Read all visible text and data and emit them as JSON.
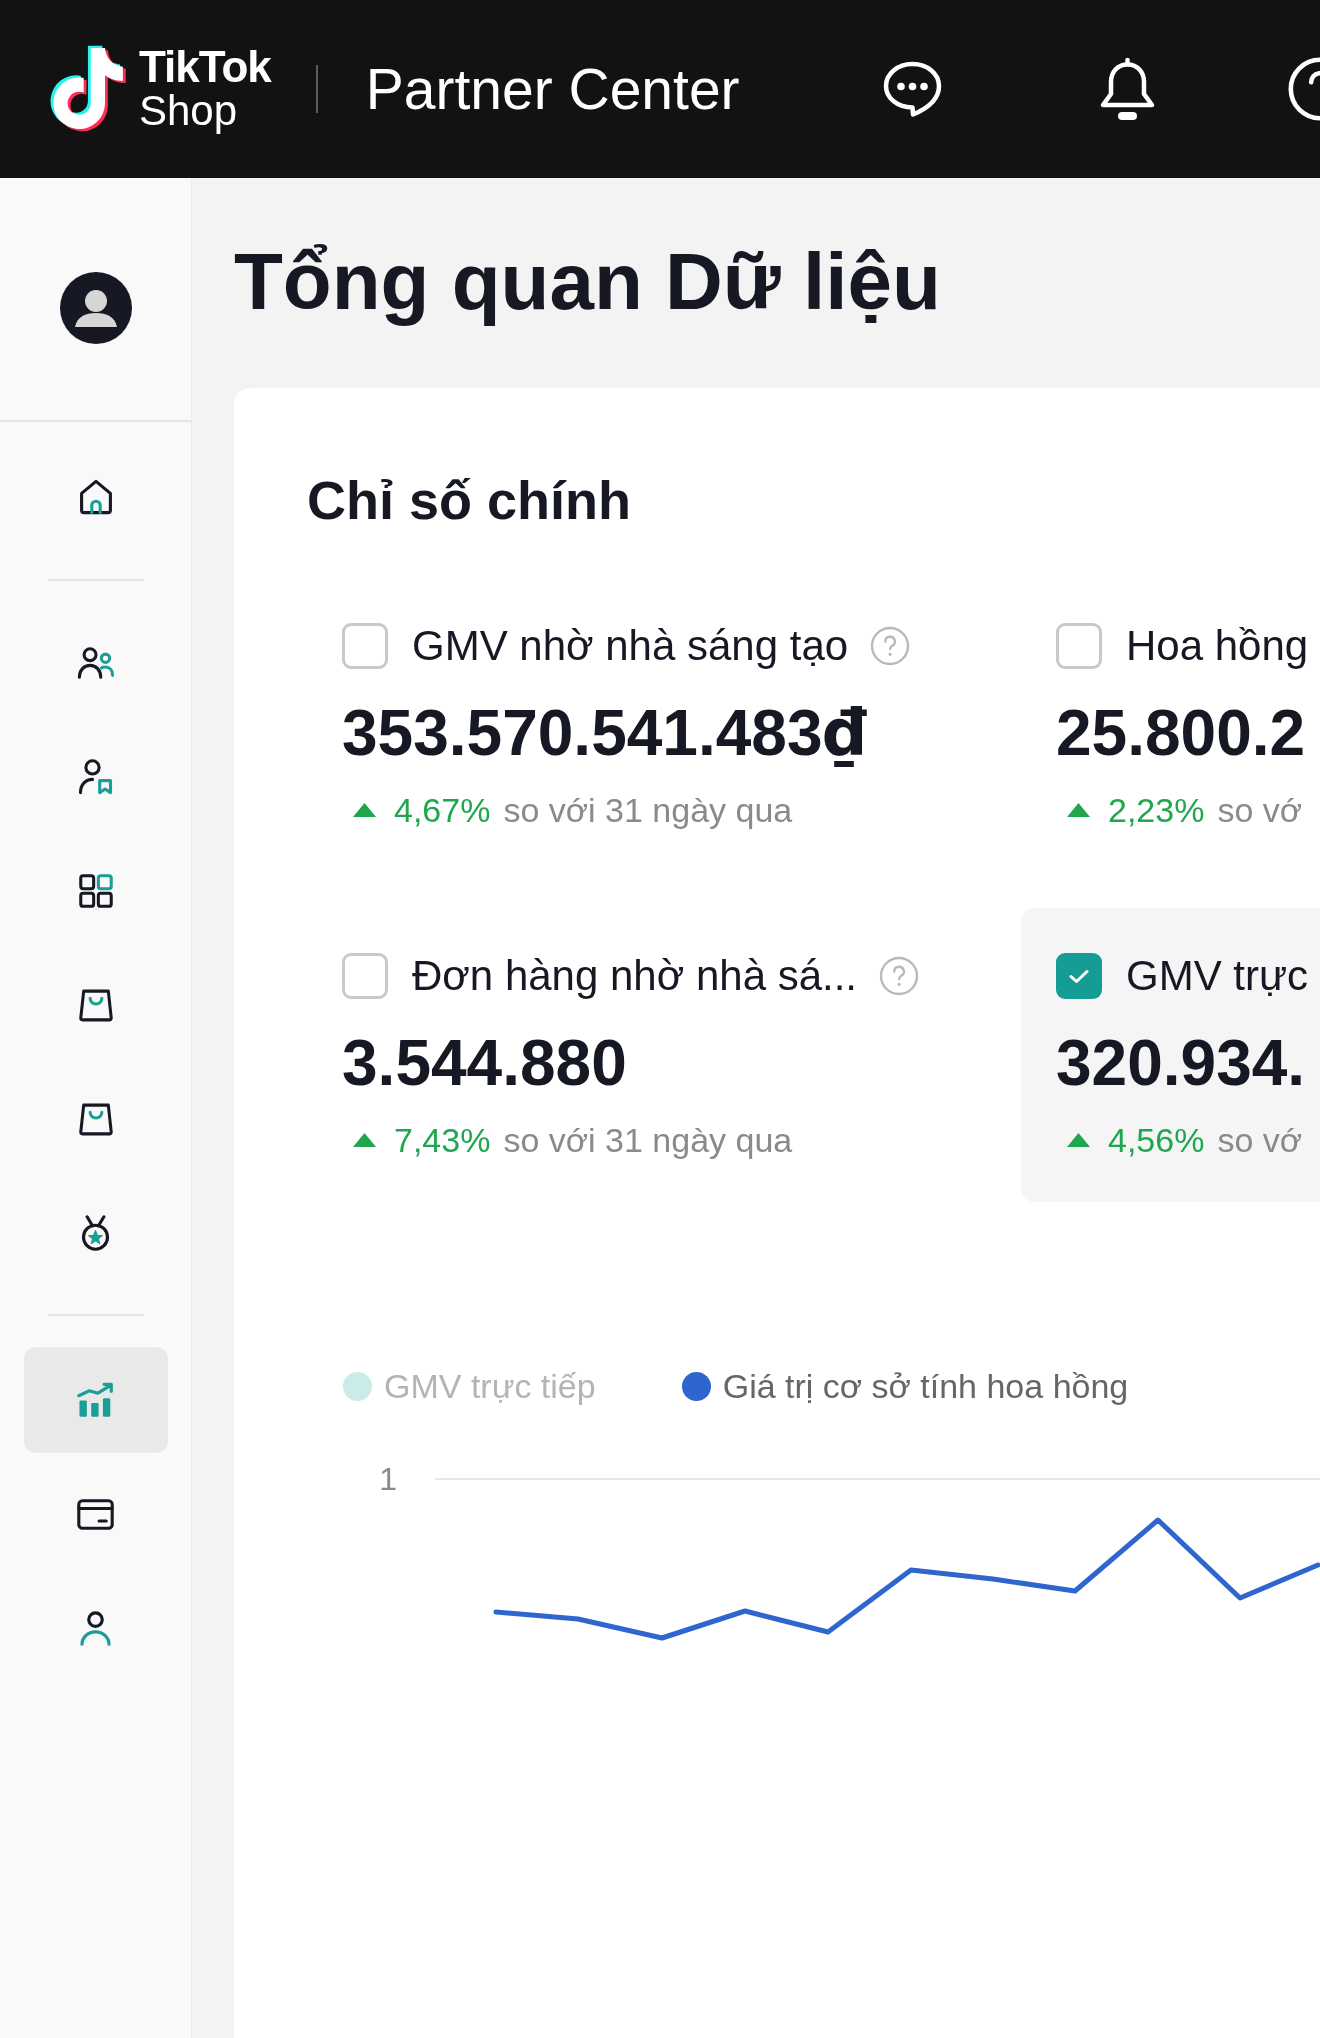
{
  "header": {
    "logo": {
      "line_1": "TikTok",
      "line_2": "Shop"
    },
    "title": "Partner Center"
  },
  "sidebar": {
    "groups": [
      {
        "items": [
          {
            "selected": false
          }
        ]
      },
      {
        "items": [
          {
            "selected": false
          },
          {
            "selected": false
          },
          {
            "selected": false
          },
          {
            "selected": false
          },
          {
            "selected": false
          },
          {
            "selected": false
          }
        ]
      },
      {
        "items": [
          {
            "selected": true
          },
          {
            "selected": false
          },
          {
            "selected": false
          }
        ]
      }
    ]
  },
  "page": {
    "title": "Tổng quan Dữ liệu"
  },
  "key_metrics": {
    "title": "Chỉ số chính",
    "metrics": [
      {
        "label": "GMV nhờ nhà sáng tạo",
        "help": true,
        "checked": false,
        "value": "353.570.541.483",
        "currency": "₫",
        "change": "4,67%",
        "increase": true,
        "comparison": "so với 31 ngày qua"
      },
      {
        "label": "Hoa hồng",
        "help": false,
        "checked": false,
        "value": "25.800.2",
        "change": "2,23%",
        "increase": true,
        "comparison": "so vớ"
      },
      {
        "label": "Đơn hàng nhờ nhà sá...",
        "help": true,
        "checked": false,
        "value": "3.544.880",
        "change": "7,43%",
        "increase": true,
        "comparison": "so với 31 ngày qua"
      },
      {
        "label": "GMV trực",
        "help": false,
        "checked": true,
        "value": "320.934.",
        "change": "4,56%",
        "increase": true,
        "comparison": "so vớ"
      }
    ]
  },
  "chart": {
    "legend": [
      {
        "label": "GMV trực tiếp",
        "color": "#c9ece8",
        "active": false
      },
      {
        "label": "Giá trị cơ sở tính hoa hồng",
        "color": "#2e65cf",
        "active": true
      }
    ],
    "y_tick": "1"
  }
}
